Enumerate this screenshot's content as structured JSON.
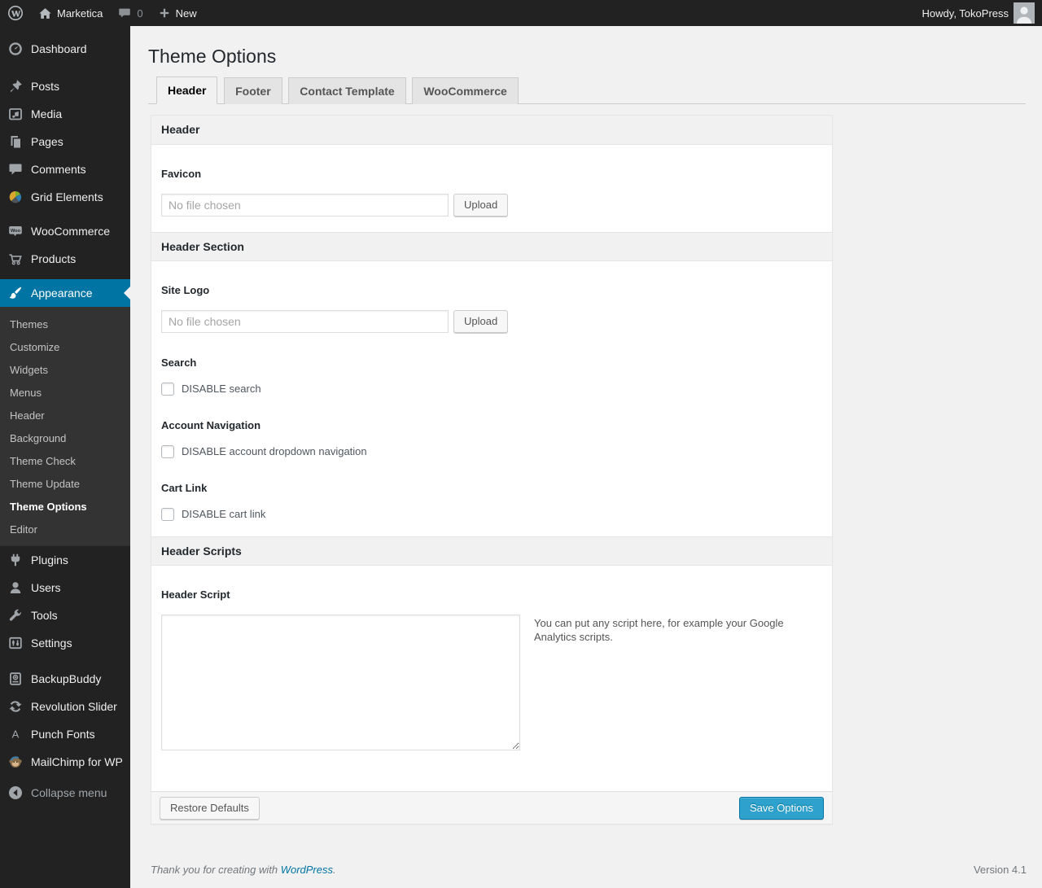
{
  "admin_bar": {
    "site_name": "Marketica",
    "comment_count": "0",
    "new_label": "New",
    "account": "Howdy, TokoPress"
  },
  "sidebar": {
    "main": [
      "Dashboard",
      "Posts",
      "Media",
      "Pages",
      "Comments",
      "Grid Elements"
    ],
    "commerce": [
      "WooCommerce",
      "Products"
    ],
    "appearance": "Appearance",
    "appearance_submenu": [
      "Themes",
      "Customize",
      "Widgets",
      "Menus",
      "Header",
      "Background",
      "Theme Check",
      "Theme Update",
      "Theme Options",
      "Editor"
    ],
    "active_submenu_item": "Theme Options",
    "admin": [
      "Plugins",
      "Users",
      "Tools",
      "Settings"
    ],
    "plugins_extra": [
      "BackupBuddy",
      "Revolution Slider",
      "Punch Fonts",
      "MailChimp for WP"
    ],
    "collapse": "Collapse menu"
  },
  "page": {
    "title": "Theme Options",
    "tabs": [
      "Header",
      "Footer",
      "Contact Template",
      "WooCommerce"
    ],
    "active_tab": "Header"
  },
  "panel": {
    "sections": {
      "header": {
        "title": "Header",
        "favicon_label": "Favicon",
        "favicon_file": "No file chosen",
        "upload": "Upload"
      },
      "header_section": {
        "title": "Header Section",
        "site_logo_label": "Site Logo",
        "site_logo_file": "No file chosen",
        "upload": "Upload",
        "search_label": "Search",
        "disable_search": "DISABLE search",
        "disable_search_checked": false,
        "account_nav_label": "Account Navigation",
        "disable_account_nav": "DISABLE account dropdown navigation",
        "disable_account_nav_checked": false,
        "cart_link_label": "Cart Link",
        "disable_cart_link": "DISABLE cart link",
        "disable_cart_link_checked": false
      },
      "header_scripts": {
        "title": "Header Scripts",
        "script_label": "Header Script",
        "script_value": "",
        "hint": "You can put any script here, for example your Google Analytics scripts."
      }
    },
    "restore_button": "Restore Defaults",
    "save_button": "Save Options"
  },
  "footer": {
    "thanks_text": "Thank you for creating with",
    "thanks_link": "WordPress",
    "thanks_period": ".",
    "version": "Version 4.1"
  },
  "colors": {
    "menu_bg": "#222222",
    "submenu_bg": "#333333",
    "accent": "#0074a2",
    "primary_button": "#2ea2cc",
    "page_bg": "#f1f1f1"
  }
}
